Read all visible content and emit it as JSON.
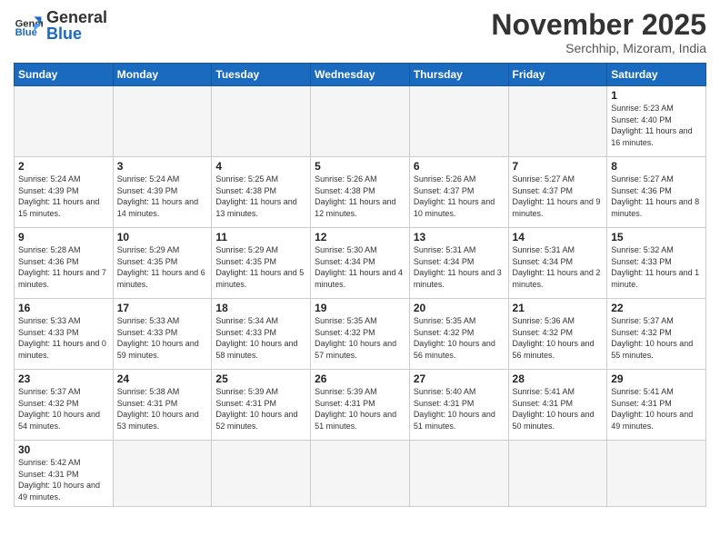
{
  "logo": {
    "general": "General",
    "blue": "Blue"
  },
  "header": {
    "month": "November 2025",
    "location": "Serchhip, Mizoram, India"
  },
  "weekdays": [
    "Sunday",
    "Monday",
    "Tuesday",
    "Wednesday",
    "Thursday",
    "Friday",
    "Saturday"
  ],
  "weeks": [
    [
      {
        "day": "",
        "info": ""
      },
      {
        "day": "",
        "info": ""
      },
      {
        "day": "",
        "info": ""
      },
      {
        "day": "",
        "info": ""
      },
      {
        "day": "",
        "info": ""
      },
      {
        "day": "",
        "info": ""
      },
      {
        "day": "1",
        "info": "Sunrise: 5:23 AM\nSunset: 4:40 PM\nDaylight: 11 hours and 16 minutes."
      }
    ],
    [
      {
        "day": "2",
        "info": "Sunrise: 5:24 AM\nSunset: 4:39 PM\nDaylight: 11 hours and 15 minutes."
      },
      {
        "day": "3",
        "info": "Sunrise: 5:24 AM\nSunset: 4:39 PM\nDaylight: 11 hours and 14 minutes."
      },
      {
        "day": "4",
        "info": "Sunrise: 5:25 AM\nSunset: 4:38 PM\nDaylight: 11 hours and 13 minutes."
      },
      {
        "day": "5",
        "info": "Sunrise: 5:26 AM\nSunset: 4:38 PM\nDaylight: 11 hours and 12 minutes."
      },
      {
        "day": "6",
        "info": "Sunrise: 5:26 AM\nSunset: 4:37 PM\nDaylight: 11 hours and 10 minutes."
      },
      {
        "day": "7",
        "info": "Sunrise: 5:27 AM\nSunset: 4:37 PM\nDaylight: 11 hours and 9 minutes."
      },
      {
        "day": "8",
        "info": "Sunrise: 5:27 AM\nSunset: 4:36 PM\nDaylight: 11 hours and 8 minutes."
      }
    ],
    [
      {
        "day": "9",
        "info": "Sunrise: 5:28 AM\nSunset: 4:36 PM\nDaylight: 11 hours and 7 minutes."
      },
      {
        "day": "10",
        "info": "Sunrise: 5:29 AM\nSunset: 4:35 PM\nDaylight: 11 hours and 6 minutes."
      },
      {
        "day": "11",
        "info": "Sunrise: 5:29 AM\nSunset: 4:35 PM\nDaylight: 11 hours and 5 minutes."
      },
      {
        "day": "12",
        "info": "Sunrise: 5:30 AM\nSunset: 4:34 PM\nDaylight: 11 hours and 4 minutes."
      },
      {
        "day": "13",
        "info": "Sunrise: 5:31 AM\nSunset: 4:34 PM\nDaylight: 11 hours and 3 minutes."
      },
      {
        "day": "14",
        "info": "Sunrise: 5:31 AM\nSunset: 4:34 PM\nDaylight: 11 hours and 2 minutes."
      },
      {
        "day": "15",
        "info": "Sunrise: 5:32 AM\nSunset: 4:33 PM\nDaylight: 11 hours and 1 minute."
      }
    ],
    [
      {
        "day": "16",
        "info": "Sunrise: 5:33 AM\nSunset: 4:33 PM\nDaylight: 11 hours and 0 minutes."
      },
      {
        "day": "17",
        "info": "Sunrise: 5:33 AM\nSunset: 4:33 PM\nDaylight: 10 hours and 59 minutes."
      },
      {
        "day": "18",
        "info": "Sunrise: 5:34 AM\nSunset: 4:33 PM\nDaylight: 10 hours and 58 minutes."
      },
      {
        "day": "19",
        "info": "Sunrise: 5:35 AM\nSunset: 4:32 PM\nDaylight: 10 hours and 57 minutes."
      },
      {
        "day": "20",
        "info": "Sunrise: 5:35 AM\nSunset: 4:32 PM\nDaylight: 10 hours and 56 minutes."
      },
      {
        "day": "21",
        "info": "Sunrise: 5:36 AM\nSunset: 4:32 PM\nDaylight: 10 hours and 56 minutes."
      },
      {
        "day": "22",
        "info": "Sunrise: 5:37 AM\nSunset: 4:32 PM\nDaylight: 10 hours and 55 minutes."
      }
    ],
    [
      {
        "day": "23",
        "info": "Sunrise: 5:37 AM\nSunset: 4:32 PM\nDaylight: 10 hours and 54 minutes."
      },
      {
        "day": "24",
        "info": "Sunrise: 5:38 AM\nSunset: 4:31 PM\nDaylight: 10 hours and 53 minutes."
      },
      {
        "day": "25",
        "info": "Sunrise: 5:39 AM\nSunset: 4:31 PM\nDaylight: 10 hours and 52 minutes."
      },
      {
        "day": "26",
        "info": "Sunrise: 5:39 AM\nSunset: 4:31 PM\nDaylight: 10 hours and 51 minutes."
      },
      {
        "day": "27",
        "info": "Sunrise: 5:40 AM\nSunset: 4:31 PM\nDaylight: 10 hours and 51 minutes."
      },
      {
        "day": "28",
        "info": "Sunrise: 5:41 AM\nSunset: 4:31 PM\nDaylight: 10 hours and 50 minutes."
      },
      {
        "day": "29",
        "info": "Sunrise: 5:41 AM\nSunset: 4:31 PM\nDaylight: 10 hours and 49 minutes."
      }
    ],
    [
      {
        "day": "30",
        "info": "Sunrise: 5:42 AM\nSunset: 4:31 PM\nDaylight: 10 hours and 49 minutes."
      },
      {
        "day": "",
        "info": ""
      },
      {
        "day": "",
        "info": ""
      },
      {
        "day": "",
        "info": ""
      },
      {
        "day": "",
        "info": ""
      },
      {
        "day": "",
        "info": ""
      },
      {
        "day": "",
        "info": ""
      }
    ]
  ]
}
